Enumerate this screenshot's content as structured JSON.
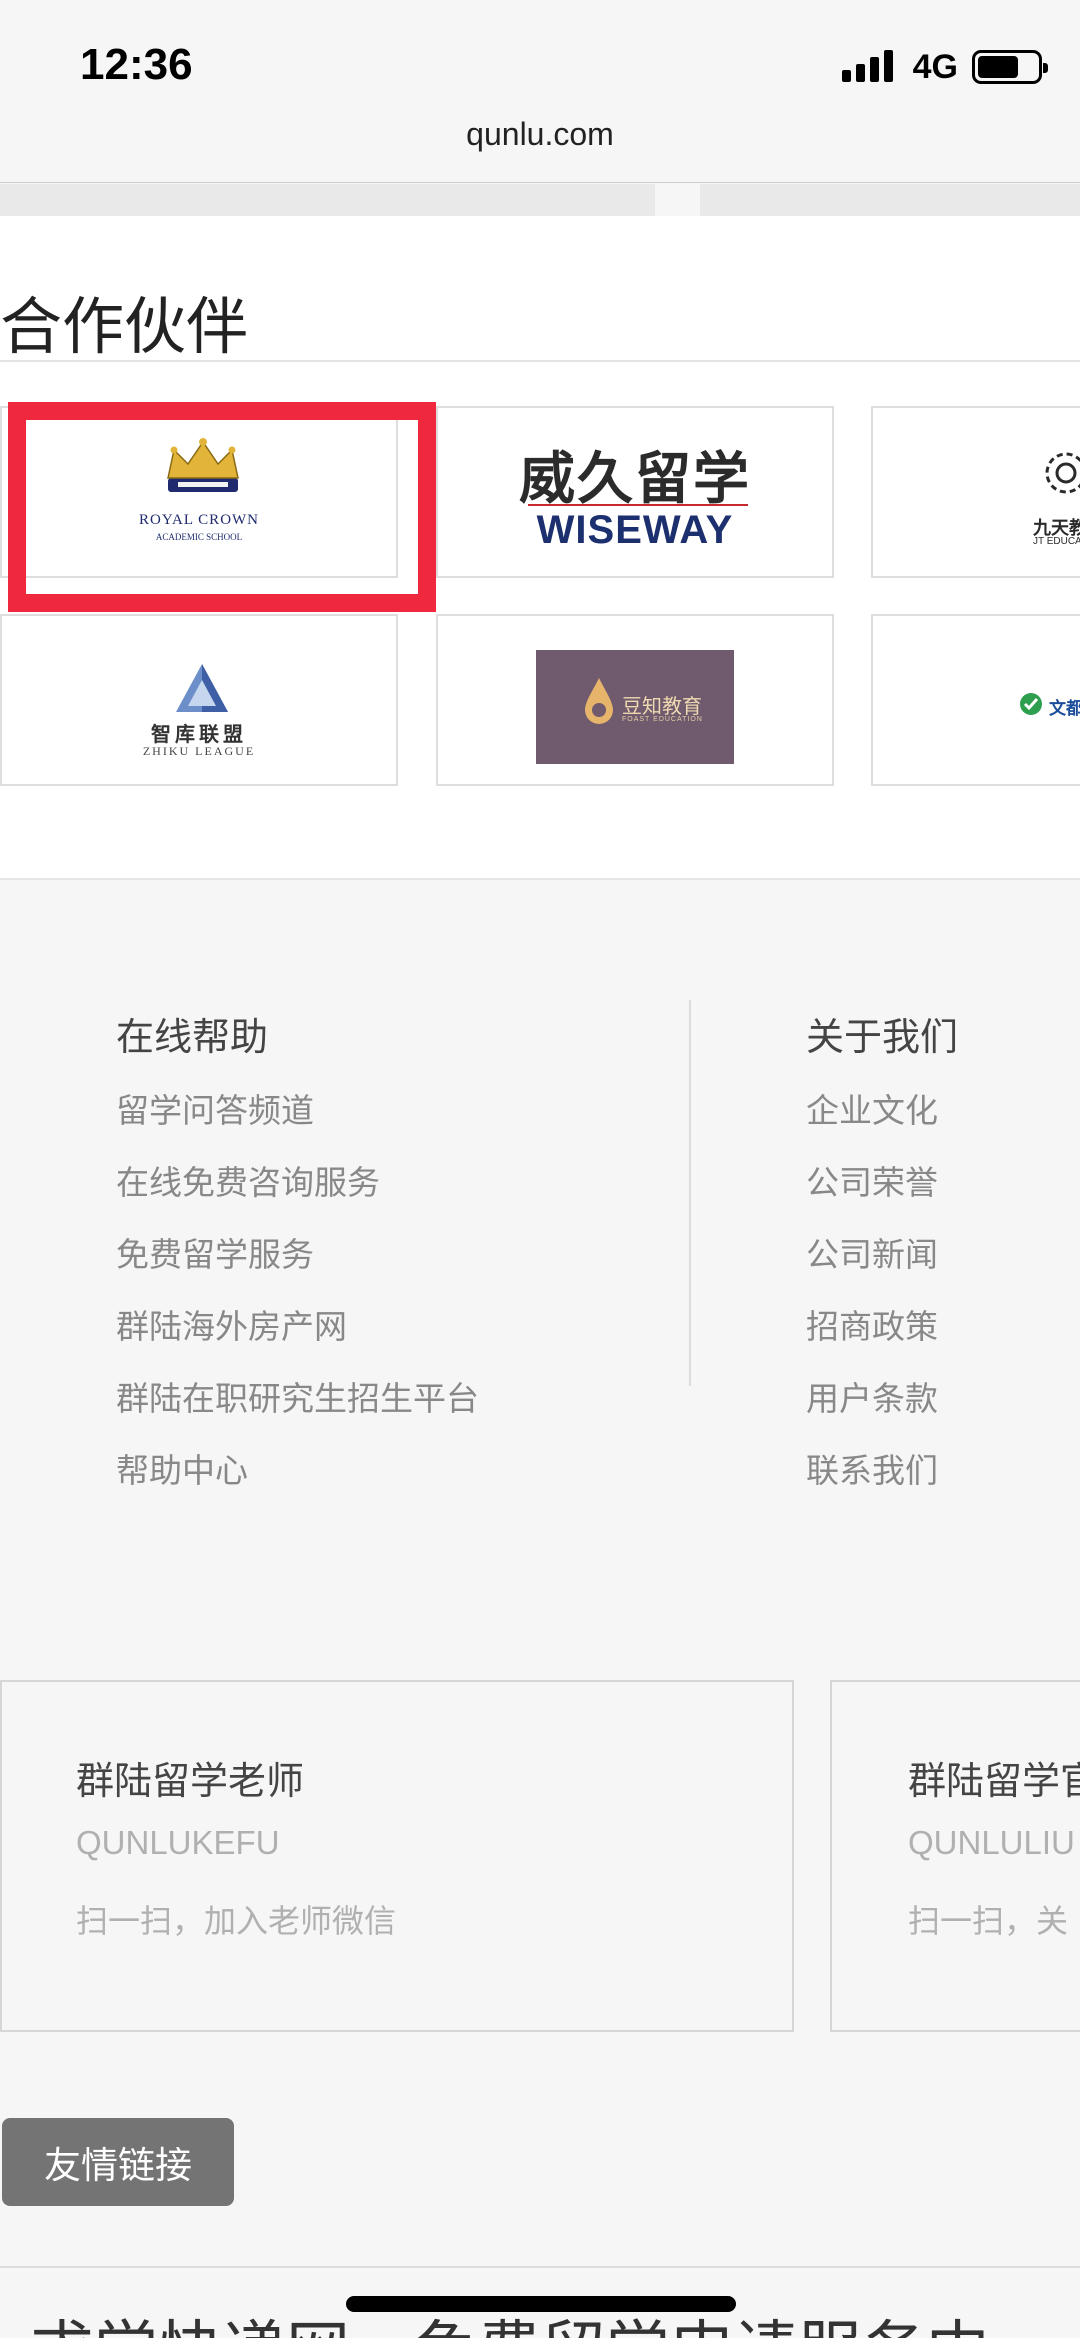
{
  "status": {
    "time": "12:36",
    "network": "4G"
  },
  "browser": {
    "url": "qunlu.com"
  },
  "partners": {
    "title": "合作伙伴",
    "royal_crown": {
      "name": "ROYAL CROWN",
      "sub": "ACADEMIC SCHOOL"
    },
    "wiseway": {
      "cn": "威久留学",
      "en": "WISEWAY"
    },
    "jt": {
      "cn": "九天教",
      "en": "JT EDUCA"
    },
    "zhiku": {
      "cn": "智库联盟",
      "en": "ZHIKU LEAGUE"
    },
    "foast": {
      "cn": "豆知教育",
      "en": "FOAST EDUCATION"
    },
    "wendu": {
      "cn": "文都国"
    }
  },
  "footer": {
    "help": {
      "heading": "在线帮助",
      "links": [
        "留学问答频道",
        "在线免费咨询服务",
        "免费留学服务",
        "群陆海外房产网",
        "群陆在职研究生招生平台",
        "帮助中心"
      ]
    },
    "about": {
      "heading": "关于我们",
      "links": [
        "企业文化",
        "公司荣誉",
        "公司新闻",
        "招商政策",
        "用户条款",
        "联系我们"
      ]
    },
    "qr_cards": [
      {
        "title": "群陆留学老师",
        "sub": "QUNLUKEFU",
        "desc": "扫一扫，加入老师微信"
      },
      {
        "title": "群陆留学官",
        "sub": "QUNLULIU",
        "desc": "扫一扫，关"
      }
    ],
    "friend_links": "友情链接"
  },
  "bottom_banner": "求学快递网 - 免费留学申请服务中"
}
